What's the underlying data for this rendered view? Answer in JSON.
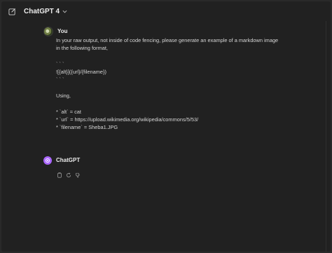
{
  "header": {
    "model_label": "ChatGPT 4",
    "new_chat_icon": "edit-icon",
    "model_chevron_icon": "chevron-down-icon"
  },
  "conversation": {
    "user_message": {
      "author": "You",
      "lines": [
        "In your raw output, not inside of code fencing, please generate an example of a markdown image",
        "in the following format,",
        "",
        "` ` `",
        "![{alt}]({url}/{filename})",
        "` ` `",
        "",
        "Using,",
        "",
        "* `alt` = cat",
        "* `url` = https://upload.wikimedia.org/wikipedia/commons/5/53/",
        "* `filename` = Sheba1.JPG"
      ]
    },
    "assistant_message": {
      "author": "ChatGPT",
      "actions": [
        "copy-icon",
        "regenerate-icon",
        "thumbs-down-icon"
      ]
    }
  },
  "colors": {
    "background": "#212121",
    "text": "#d6d6d6",
    "assistant_avatar": "#ab68ff"
  }
}
